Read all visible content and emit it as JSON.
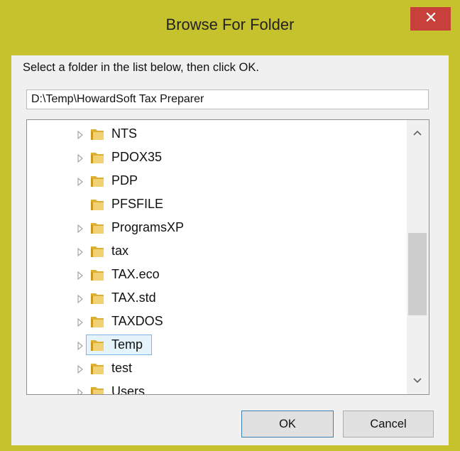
{
  "window": {
    "title": "Browse For Folder",
    "frame_color": "#c6c22e",
    "close_color": "#c7403a",
    "close_symbol": "✕"
  },
  "dialog": {
    "instruction": "Select a folder in the list below, then click OK.",
    "path_value": "D:\\Temp\\HowardSoft Tax Preparer"
  },
  "tree": {
    "items": [
      {
        "label": "NTS",
        "expandable": true,
        "selected": false
      },
      {
        "label": "PDOX35",
        "expandable": true,
        "selected": false
      },
      {
        "label": "PDP",
        "expandable": true,
        "selected": false
      },
      {
        "label": "PFSFILE",
        "expandable": false,
        "selected": false
      },
      {
        "label": "ProgramsXP",
        "expandable": true,
        "selected": false
      },
      {
        "label": "tax",
        "expandable": true,
        "selected": false
      },
      {
        "label": "TAX.eco",
        "expandable": true,
        "selected": false
      },
      {
        "label": "TAX.std",
        "expandable": true,
        "selected": false
      },
      {
        "label": "TAXDOS",
        "expandable": true,
        "selected": false
      },
      {
        "label": "Temp",
        "expandable": true,
        "selected": true
      },
      {
        "label": "test",
        "expandable": true,
        "selected": false
      },
      {
        "label": "Users",
        "expandable": true,
        "selected": false
      }
    ]
  },
  "buttons": {
    "ok": "OK",
    "cancel": "Cancel"
  }
}
